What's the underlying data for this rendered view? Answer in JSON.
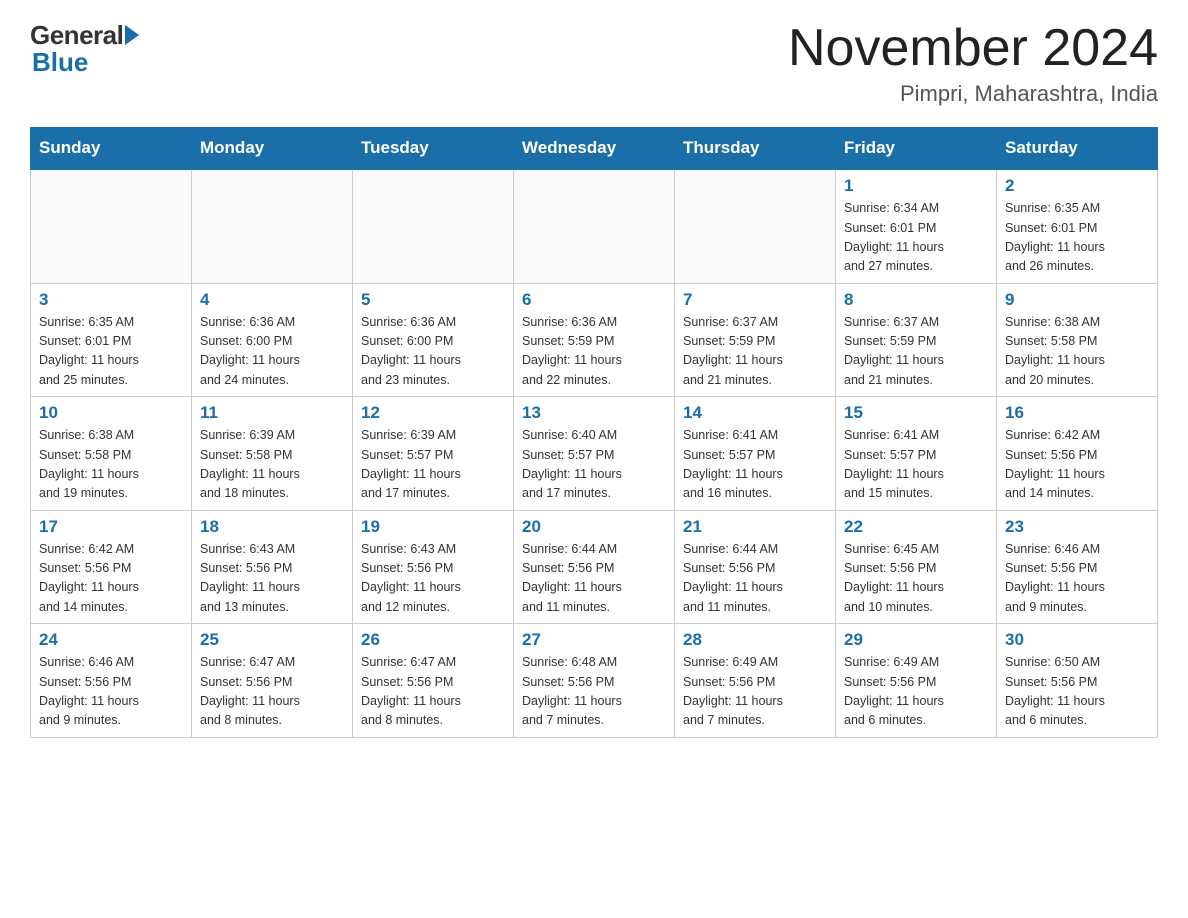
{
  "logo": {
    "general": "General",
    "blue": "Blue"
  },
  "header": {
    "month": "November 2024",
    "location": "Pimpri, Maharashtra, India"
  },
  "weekdays": [
    "Sunday",
    "Monday",
    "Tuesday",
    "Wednesday",
    "Thursday",
    "Friday",
    "Saturday"
  ],
  "weeks": [
    [
      {
        "day": "",
        "empty": true
      },
      {
        "day": "",
        "empty": true
      },
      {
        "day": "",
        "empty": true
      },
      {
        "day": "",
        "empty": true
      },
      {
        "day": "",
        "empty": true
      },
      {
        "day": "1",
        "sunrise": "6:34 AM",
        "sunset": "6:01 PM",
        "daylight": "11 hours and 27 minutes."
      },
      {
        "day": "2",
        "sunrise": "6:35 AM",
        "sunset": "6:01 PM",
        "daylight": "11 hours and 26 minutes."
      }
    ],
    [
      {
        "day": "3",
        "sunrise": "6:35 AM",
        "sunset": "6:01 PM",
        "daylight": "11 hours and 25 minutes."
      },
      {
        "day": "4",
        "sunrise": "6:36 AM",
        "sunset": "6:00 PM",
        "daylight": "11 hours and 24 minutes."
      },
      {
        "day": "5",
        "sunrise": "6:36 AM",
        "sunset": "6:00 PM",
        "daylight": "11 hours and 23 minutes."
      },
      {
        "day": "6",
        "sunrise": "6:36 AM",
        "sunset": "5:59 PM",
        "daylight": "11 hours and 22 minutes."
      },
      {
        "day": "7",
        "sunrise": "6:37 AM",
        "sunset": "5:59 PM",
        "daylight": "11 hours and 21 minutes."
      },
      {
        "day": "8",
        "sunrise": "6:37 AM",
        "sunset": "5:59 PM",
        "daylight": "11 hours and 21 minutes."
      },
      {
        "day": "9",
        "sunrise": "6:38 AM",
        "sunset": "5:58 PM",
        "daylight": "11 hours and 20 minutes."
      }
    ],
    [
      {
        "day": "10",
        "sunrise": "6:38 AM",
        "sunset": "5:58 PM",
        "daylight": "11 hours and 19 minutes."
      },
      {
        "day": "11",
        "sunrise": "6:39 AM",
        "sunset": "5:58 PM",
        "daylight": "11 hours and 18 minutes."
      },
      {
        "day": "12",
        "sunrise": "6:39 AM",
        "sunset": "5:57 PM",
        "daylight": "11 hours and 17 minutes."
      },
      {
        "day": "13",
        "sunrise": "6:40 AM",
        "sunset": "5:57 PM",
        "daylight": "11 hours and 17 minutes."
      },
      {
        "day": "14",
        "sunrise": "6:41 AM",
        "sunset": "5:57 PM",
        "daylight": "11 hours and 16 minutes."
      },
      {
        "day": "15",
        "sunrise": "6:41 AM",
        "sunset": "5:57 PM",
        "daylight": "11 hours and 15 minutes."
      },
      {
        "day": "16",
        "sunrise": "6:42 AM",
        "sunset": "5:56 PM",
        "daylight": "11 hours and 14 minutes."
      }
    ],
    [
      {
        "day": "17",
        "sunrise": "6:42 AM",
        "sunset": "5:56 PM",
        "daylight": "11 hours and 14 minutes."
      },
      {
        "day": "18",
        "sunrise": "6:43 AM",
        "sunset": "5:56 PM",
        "daylight": "11 hours and 13 minutes."
      },
      {
        "day": "19",
        "sunrise": "6:43 AM",
        "sunset": "5:56 PM",
        "daylight": "11 hours and 12 minutes."
      },
      {
        "day": "20",
        "sunrise": "6:44 AM",
        "sunset": "5:56 PM",
        "daylight": "11 hours and 11 minutes."
      },
      {
        "day": "21",
        "sunrise": "6:44 AM",
        "sunset": "5:56 PM",
        "daylight": "11 hours and 11 minutes."
      },
      {
        "day": "22",
        "sunrise": "6:45 AM",
        "sunset": "5:56 PM",
        "daylight": "11 hours and 10 minutes."
      },
      {
        "day": "23",
        "sunrise": "6:46 AM",
        "sunset": "5:56 PM",
        "daylight": "11 hours and 9 minutes."
      }
    ],
    [
      {
        "day": "24",
        "sunrise": "6:46 AM",
        "sunset": "5:56 PM",
        "daylight": "11 hours and 9 minutes."
      },
      {
        "day": "25",
        "sunrise": "6:47 AM",
        "sunset": "5:56 PM",
        "daylight": "11 hours and 8 minutes."
      },
      {
        "day": "26",
        "sunrise": "6:47 AM",
        "sunset": "5:56 PM",
        "daylight": "11 hours and 8 minutes."
      },
      {
        "day": "27",
        "sunrise": "6:48 AM",
        "sunset": "5:56 PM",
        "daylight": "11 hours and 7 minutes."
      },
      {
        "day": "28",
        "sunrise": "6:49 AM",
        "sunset": "5:56 PM",
        "daylight": "11 hours and 7 minutes."
      },
      {
        "day": "29",
        "sunrise": "6:49 AM",
        "sunset": "5:56 PM",
        "daylight": "11 hours and 6 minutes."
      },
      {
        "day": "30",
        "sunrise": "6:50 AM",
        "sunset": "5:56 PM",
        "daylight": "11 hours and 6 minutes."
      }
    ]
  ],
  "labels": {
    "sunrise": "Sunrise:",
    "sunset": "Sunset:",
    "daylight": "Daylight:"
  }
}
